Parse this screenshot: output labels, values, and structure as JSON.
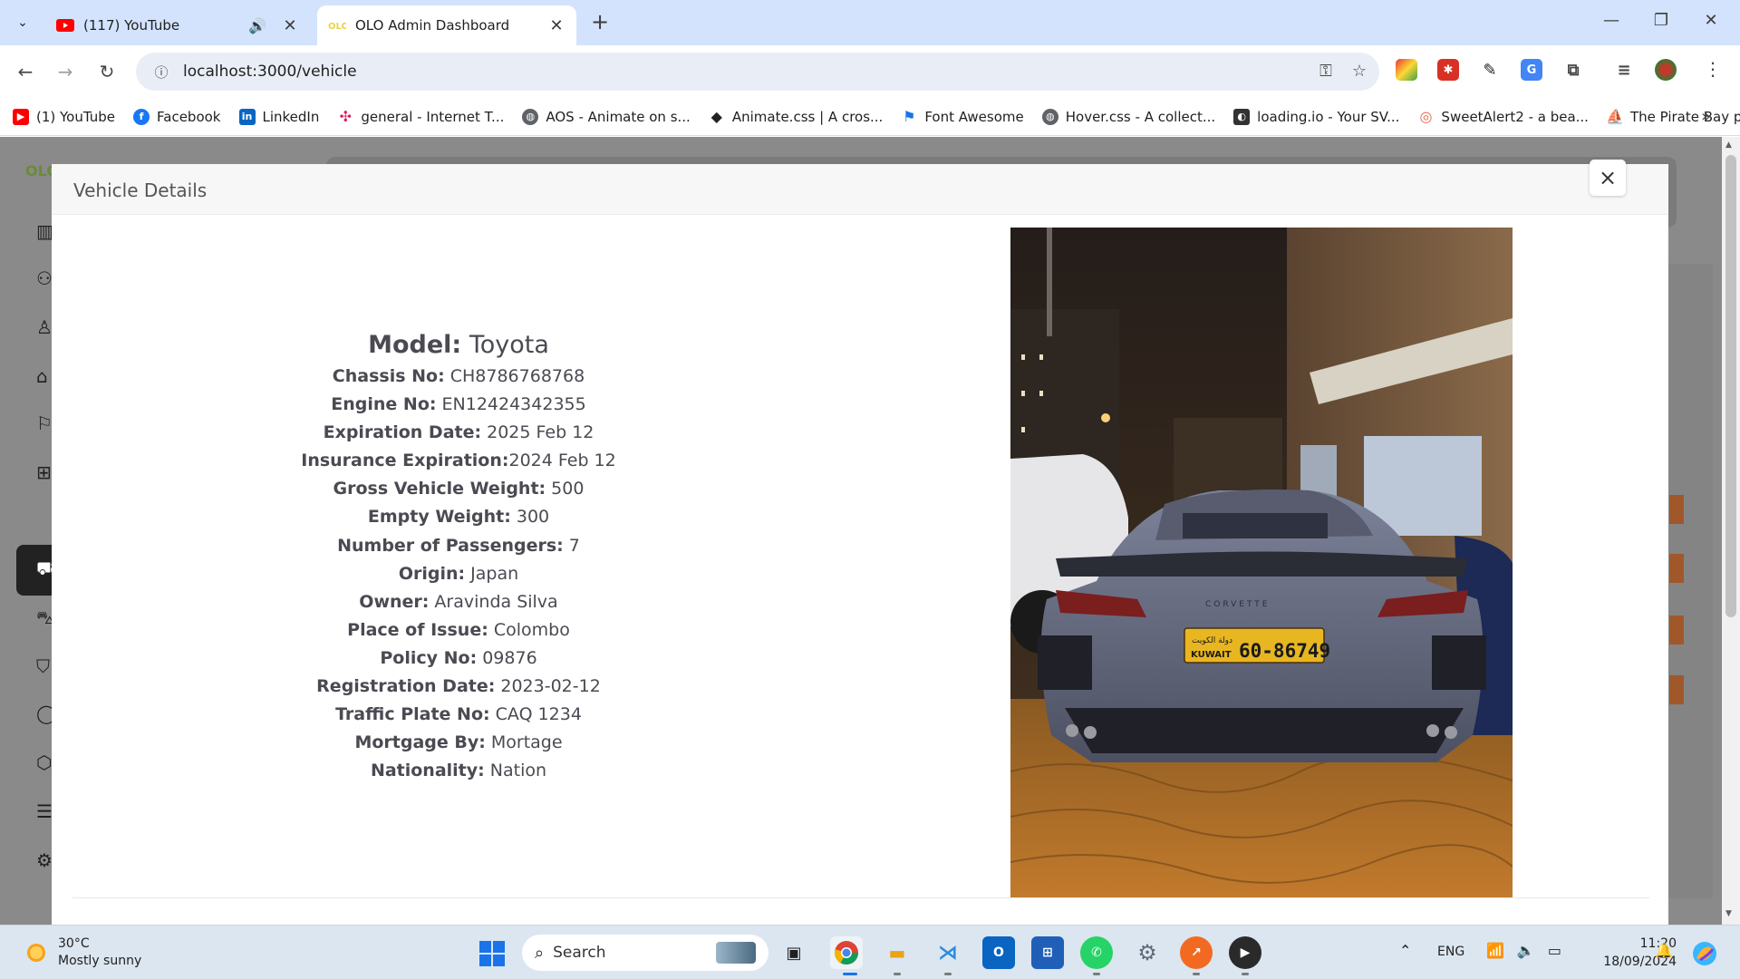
{
  "browser": {
    "tabs": [
      {
        "title": "(117) YouTube",
        "active": false,
        "audio": true
      },
      {
        "title": "OLO Admin Dashboard",
        "active": true,
        "audio": false
      }
    ],
    "url": "localhost:3000/vehicle",
    "bookmarks": [
      {
        "label": "(1) YouTube",
        "icon": "youtube-icon",
        "color": "#ff0000"
      },
      {
        "label": "Facebook",
        "icon": "facebook-icon",
        "color": "#1877f2"
      },
      {
        "label": "LinkedIn",
        "icon": "linkedin-icon",
        "color": "#0a66c2"
      },
      {
        "label": "general - Internet T...",
        "icon": "slack-icon",
        "color": "#e01e5a"
      },
      {
        "label": "AOS - Animate on s...",
        "icon": "globe-icon",
        "color": "#5f6368"
      },
      {
        "label": "Animate.css | A cros...",
        "icon": "diamond-icon",
        "color": "#222222"
      },
      {
        "label": "Font Awesome",
        "icon": "flag-icon",
        "color": "#1a73e8"
      },
      {
        "label": "Hover.css - A collect...",
        "icon": "globe-icon",
        "color": "#5f6368"
      },
      {
        "label": "loading.io - Your SV...",
        "icon": "loading-icon",
        "color": "#333333"
      },
      {
        "label": "SweetAlert2 - a bea...",
        "icon": "sweetalert-icon",
        "color": "#e6674a"
      },
      {
        "label": "The Pirate Bay prox...",
        "icon": "ship-icon",
        "color": "#8a6a3a"
      }
    ]
  },
  "modal": {
    "title": "Vehicle Details",
    "close_symbol": "×"
  },
  "vehicle": {
    "model_label": "Model:",
    "model": "Toyota",
    "fields": [
      {
        "label": "Chassis No:",
        "value": " CH8786768768"
      },
      {
        "label": "Engine No:",
        "value": " EN12424342355"
      },
      {
        "label": "Expiration Date:",
        "value": " 2025 Feb 12"
      },
      {
        "label": "Insurance Expiration:",
        "value": "2024 Feb 12"
      },
      {
        "label": "Gross Vehicle Weight:",
        "value": " 500"
      },
      {
        "label": "Empty Weight:",
        "value": " 300"
      },
      {
        "label": "Number of Passengers:",
        "value": " 7"
      },
      {
        "label": "Origin:",
        "value": " Japan"
      },
      {
        "label": "Owner:",
        "value": " Aravinda Silva"
      },
      {
        "label": "Place of Issue:",
        "value": " Colombo"
      },
      {
        "label": "Policy No:",
        "value": " 09876"
      },
      {
        "label": "Registration Date:",
        "value": " 2023-02-12"
      },
      {
        "label": "Traffic Plate No:",
        "value": " CAQ 1234"
      },
      {
        "label": "Mortgage By:",
        "value": " Mortage"
      },
      {
        "label": "Nationality:",
        "value": " Nation"
      }
    ],
    "photo": {
      "plate_top": "دولة الكويت",
      "plate_country": "KUWAIT",
      "plate_number": "60-86749",
      "badge": "CORVETTE"
    }
  },
  "background_page": {
    "logo": "OLO"
  },
  "taskbar": {
    "weather_temp": "30°C",
    "weather_desc": "Mostly sunny",
    "search_placeholder": "Search",
    "language": "ENG",
    "time": "11:20",
    "date": "18/09/2024"
  }
}
